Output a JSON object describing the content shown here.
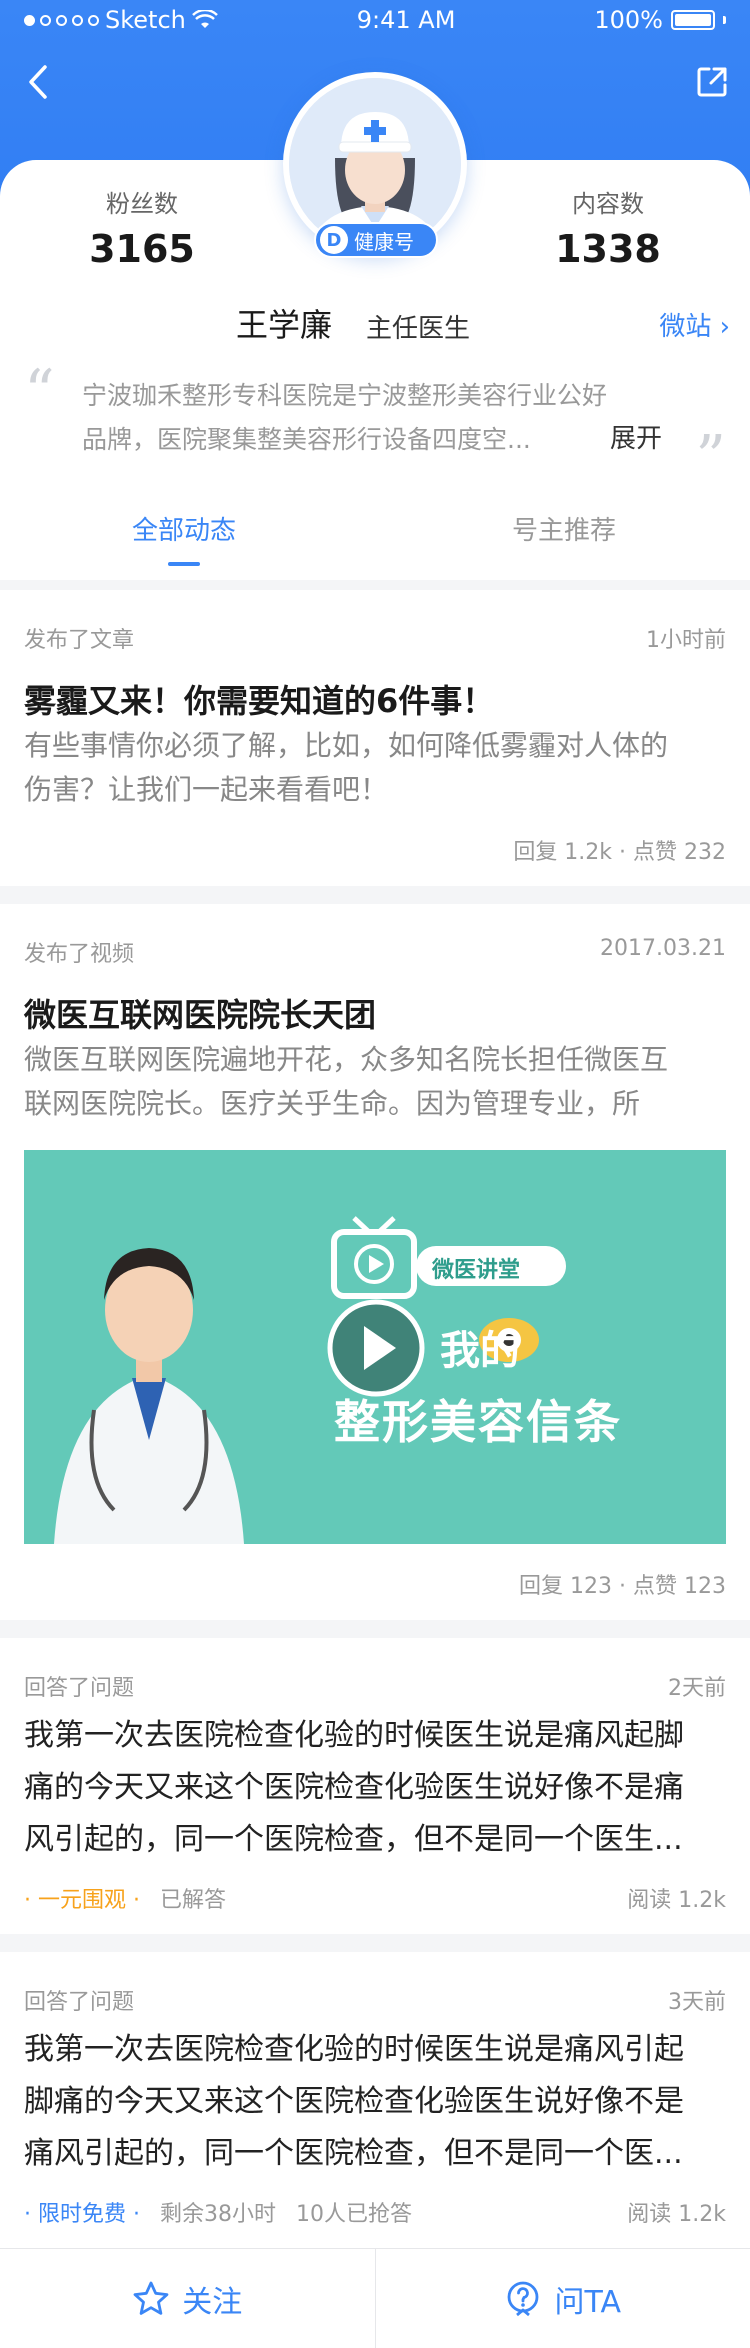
{
  "status_bar": {
    "carrier": "Sketch",
    "time": "9:41 AM",
    "battery": "100%"
  },
  "profile": {
    "fans_label": "粉丝数",
    "fans": "3165",
    "content_label": "内容数",
    "content": "1338",
    "badge": "健康号",
    "badge_letter": "D",
    "name": "王学廉",
    "title": "主任医生",
    "weizhan": "微站 ›",
    "intro_line1": "宁波珈禾整形专科医院是宁波整形美容行业公好",
    "intro_line2": "品牌，医院聚集整美容形行设备四度空...",
    "expand": "展开"
  },
  "tabs": [
    {
      "label": "全部动态",
      "active": true
    },
    {
      "label": "号主推荐",
      "active": false
    }
  ],
  "feed": [
    {
      "type": "发布了文章",
      "time": "1小时前",
      "headline": "雾霾又来！你需要知道的6件事！",
      "desc_line1": "有些事情你必须了解，比如，如何降低雾霾对人体的",
      "desc_line2": "伤害？让我们一起来看看吧！",
      "stats": "回复 1.2k · 点赞 232"
    },
    {
      "type": "发布了视频",
      "time": "2017.03.21",
      "headline": "微医互联网医院院长天团",
      "desc_line1": "微医互联网医院遍地开花，众多知名院长担任微医互",
      "desc_line2": "联网医院院长。医疗关乎生命。因为管理专业，所",
      "video_caption1": "微医讲堂",
      "video_caption2": "我的",
      "video_caption3": "整形美容信条",
      "stats": "回复 123 · 点赞 123"
    },
    {
      "type": "回答了问题",
      "time": "2天前",
      "q_line1": "我第一次去医院检查化验的时候医生说是痛风起脚",
      "q_line2": "痛的今天又来这个医院检查化验医生说好像不是痛",
      "q_line3": "风引起的，同一个医院检查，但不是同一个医生...",
      "tag1": "· 一元围观 ·",
      "tag2": "已解答",
      "stats": "阅读 1.2k"
    },
    {
      "type": "回答了问题",
      "time": "3天前",
      "q_line1": "我第一次去医院检查化验的时候医生说是痛风引起",
      "q_line2": "脚痛的今天又来这个医院检查化验医生说好像不是",
      "q_line3": "痛风引起的，同一个医院检查，但不是同一个医...",
      "tag1": "· 限时免费 ·",
      "tag2": "剩余38小时",
      "tag3": "10人已抢答",
      "stats": "阅读 1.2k"
    }
  ],
  "bottom": {
    "follow": "关注",
    "ask": "问TA"
  },
  "colors": {
    "primary": "#3a86f6",
    "orange": "#f7a21b"
  }
}
